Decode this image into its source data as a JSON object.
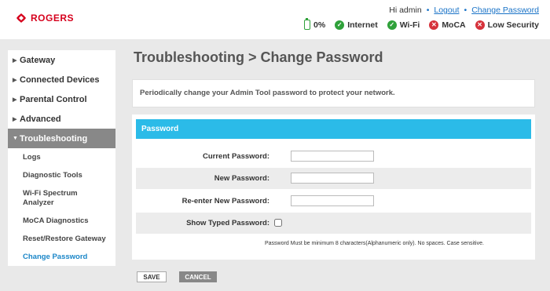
{
  "header": {
    "logo_text": "ROGERS",
    "greeting": "Hi admin",
    "logout": "Logout",
    "separator": "•",
    "change_password_link": "Change Password",
    "status": [
      {
        "icon": "battery-icon",
        "label": "0%",
        "state": "ok"
      },
      {
        "icon": "check-icon",
        "label": "Internet",
        "state": "ok"
      },
      {
        "icon": "check-icon",
        "label": "Wi-Fi",
        "state": "ok"
      },
      {
        "icon": "x-icon",
        "label": "MoCA",
        "state": "bad"
      },
      {
        "icon": "x-icon",
        "label": "Low Security",
        "state": "bad"
      }
    ]
  },
  "sidebar": {
    "items": [
      {
        "label": "Gateway"
      },
      {
        "label": "Connected Devices"
      },
      {
        "label": "Parental Control"
      },
      {
        "label": "Advanced"
      },
      {
        "label": "Troubleshooting"
      }
    ],
    "subitems": [
      {
        "label": "Logs"
      },
      {
        "label": "Diagnostic Tools"
      },
      {
        "label": "Wi-Fi Spectrum Analyzer"
      },
      {
        "label": "MoCA Diagnostics"
      },
      {
        "label": "Reset/Restore Gateway"
      },
      {
        "label": "Change Password"
      }
    ]
  },
  "main": {
    "title": "Troubleshooting > Change Password",
    "notice": "Periodically change your Admin Tool password to protect your network.",
    "panel_title": "Password",
    "fields": {
      "current": {
        "label": "Current Password:",
        "value": ""
      },
      "new": {
        "label": "New Password:",
        "value": ""
      },
      "reenter": {
        "label": "Re-enter New Password:",
        "value": ""
      },
      "show": {
        "label": "Show Typed Password:",
        "checked": false
      }
    },
    "hint": "Password Must be minimum 8 characters(Alphanumeric only). No spaces. Case sensitive.",
    "save_label": "SAVE",
    "cancel_label": "CANCEL"
  },
  "colors": {
    "brand": "#d6001c",
    "accent": "#2bbbe8",
    "ok": "#2fa13a",
    "bad": "#d6323b",
    "link": "#1a73c7"
  }
}
